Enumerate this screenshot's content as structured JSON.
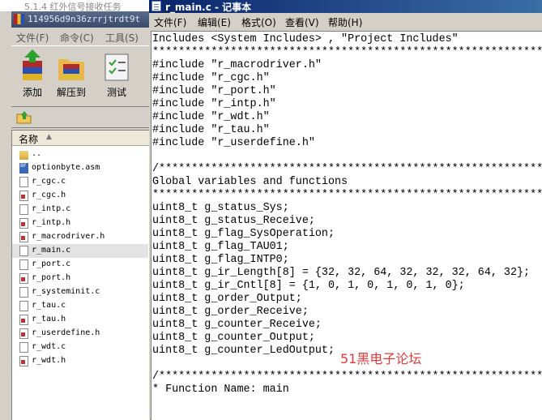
{
  "archive": {
    "doc_strip_text": "5.1.4  红外信号接收任务",
    "title": "114956d9n36zrrjtrdt9t",
    "menu": [
      "文件(F)",
      "命令(C)",
      "工具(S)"
    ],
    "toolbar": [
      {
        "label": "添加",
        "icon": "add-books-icon"
      },
      {
        "label": "解压到",
        "icon": "extract-folder-icon"
      },
      {
        "label": "测试",
        "icon": "test-checklist-icon"
      }
    ],
    "column_header": "名称",
    "files": [
      {
        "name": "..",
        "type": "folder"
      },
      {
        "name": "optionbyte.asm",
        "type": "asm"
      },
      {
        "name": "r_cgc.c",
        "type": "c"
      },
      {
        "name": "r_cgc.h",
        "type": "h"
      },
      {
        "name": "r_intp.c",
        "type": "c"
      },
      {
        "name": "r_intp.h",
        "type": "h"
      },
      {
        "name": "r_macrodriver.h",
        "type": "h"
      },
      {
        "name": "r_main.c",
        "type": "c",
        "selected": true
      },
      {
        "name": "r_port.c",
        "type": "c"
      },
      {
        "name": "r_port.h",
        "type": "h"
      },
      {
        "name": "r_systeminit.c",
        "type": "c"
      },
      {
        "name": "r_tau.c",
        "type": "c"
      },
      {
        "name": "r_tau.h",
        "type": "h"
      },
      {
        "name": "r_userdefine.h",
        "type": "h"
      },
      {
        "name": "r_wdt.c",
        "type": "c"
      },
      {
        "name": "r_wdt.h",
        "type": "h"
      }
    ]
  },
  "notepad": {
    "title": "r_main.c - 记事本",
    "menu": [
      "文件(F)",
      "编辑(E)",
      "格式(O)",
      "查看(V)",
      "帮助(H)"
    ],
    "lines": [
      "Includes <System Includes> , \"Project Includes\"",
      "**************************************************************************",
      "#include \"r_macrodriver.h\"",
      "#include \"r_cgc.h\"",
      "#include \"r_port.h\"",
      "#include \"r_intp.h\"",
      "#include \"r_wdt.h\"",
      "#include \"r_tau.h\"",
      "#include \"r_userdefine.h\"",
      "",
      "/*************************************************************************",
      "Global variables and functions",
      "**************************************************************************",
      "uint8_t g_status_Sys;",
      "uint8_t g_status_Receive;",
      "uint8_t g_flag_SysOperation;",
      "uint8_t g_flag_TAU01;",
      "uint8_t g_flag_INTP0;",
      "uint8_t g_ir_Length[8] = {32, 32, 64, 32, 32, 32, 64, 32};",
      "uint8_t g_ir_Cntl[8] = {1, 0, 1, 0, 1, 0, 1, 0};",
      "uint8_t g_order_Output;",
      "uint8_t g_order_Receive;",
      "uint8_t g_counter_Receive;",
      "uint8_t g_counter_Output;",
      "uint8_t g_counter_LedOutput;",
      "",
      "/*************************************************************************",
      "* Function Name: main"
    ],
    "watermark": "51黑电子论坛"
  }
}
